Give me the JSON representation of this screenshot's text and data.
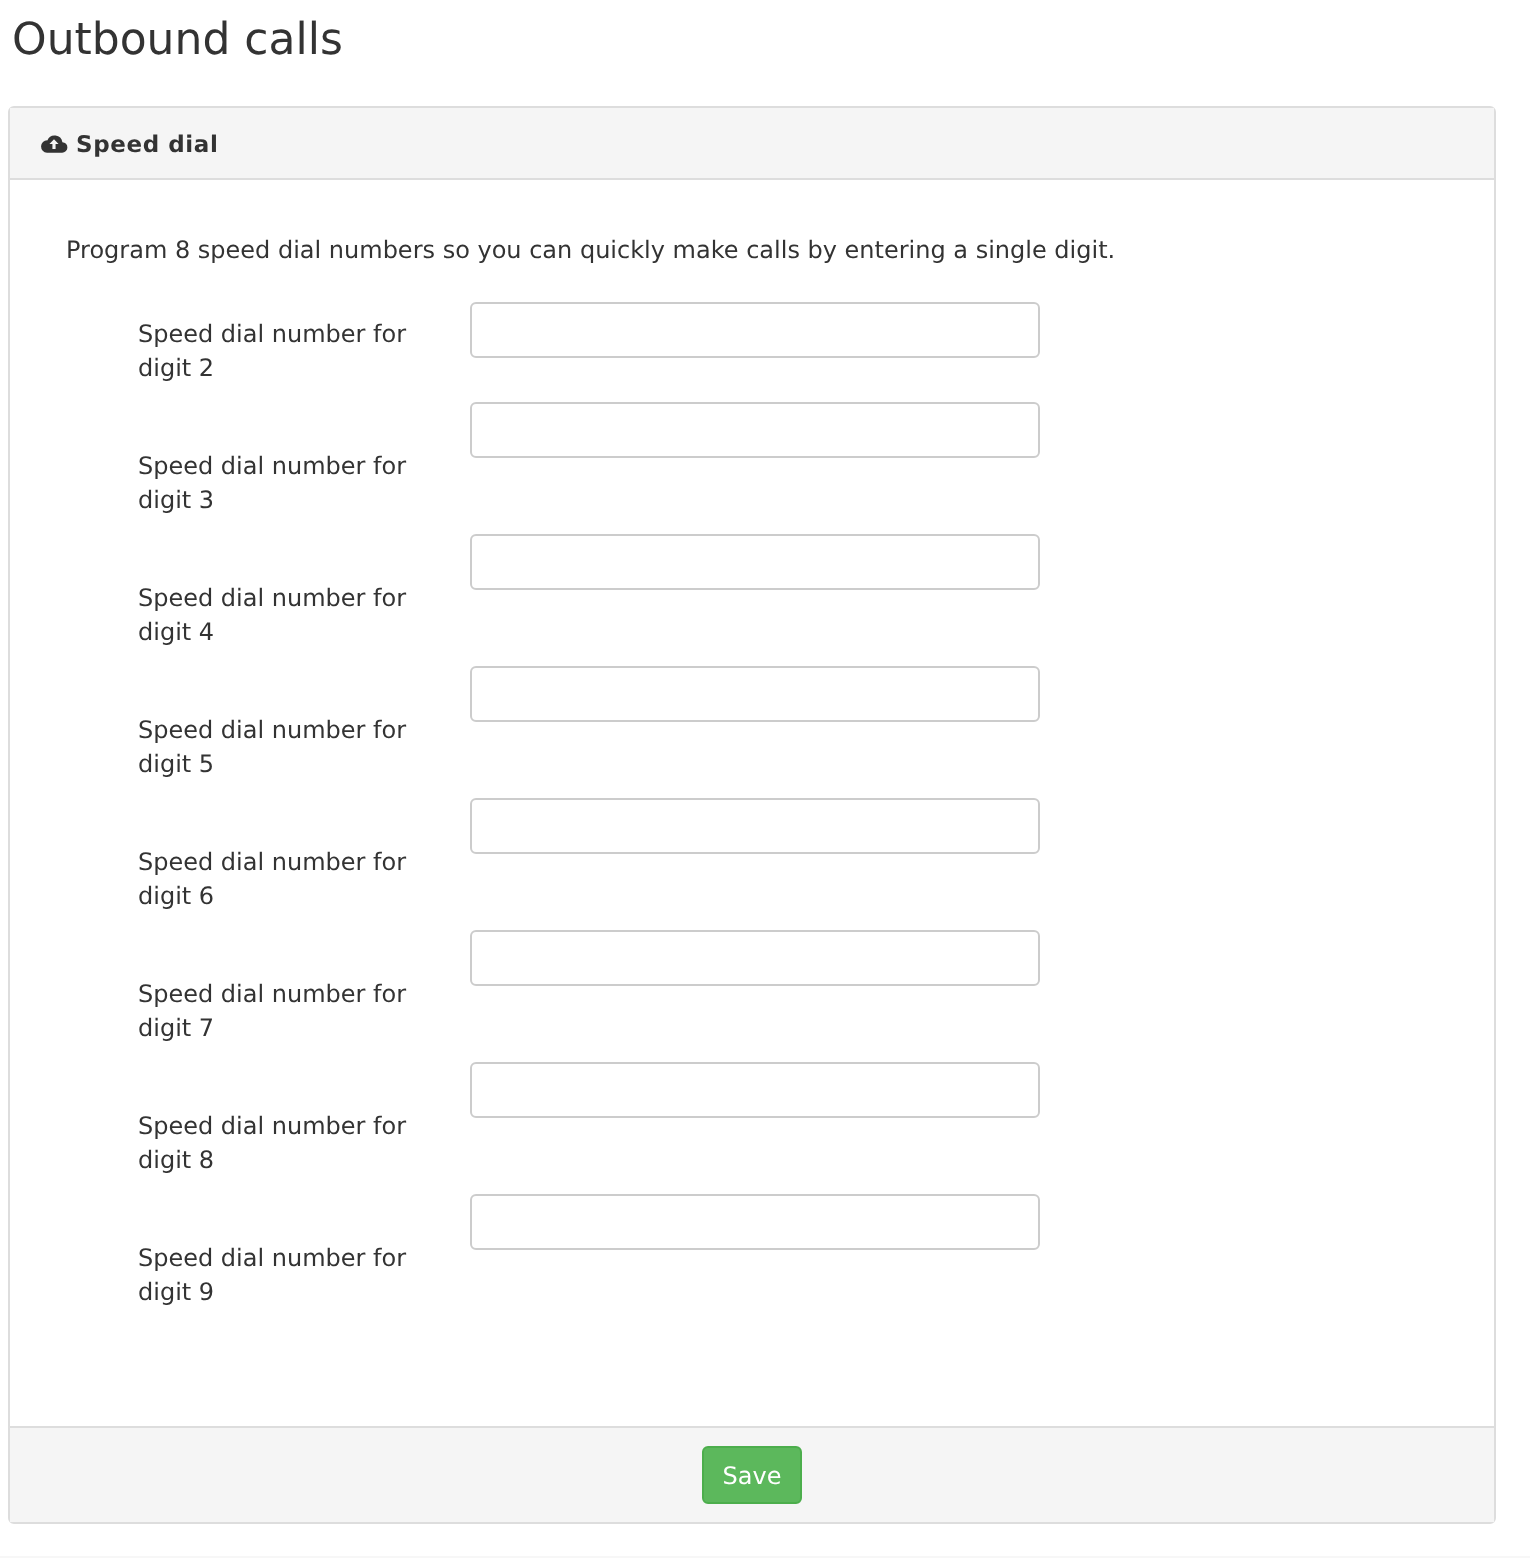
{
  "page_title": "Outbound calls",
  "panel": {
    "heading": "Speed dial",
    "intro": "Program 8 speed dial numbers so you can quickly make calls by entering a single digit.",
    "fields": [
      {
        "label": "Speed dial number for digit 2"
      },
      {
        "label": "Speed dial number for digit 3"
      },
      {
        "label": "Speed dial number for digit 4"
      },
      {
        "label": "Speed dial number for digit 5"
      },
      {
        "label": "Speed dial number for digit 6"
      },
      {
        "label": "Speed dial number for digit 7"
      },
      {
        "label": "Speed dial number for digit 8"
      },
      {
        "label": "Speed dial number for digit 9"
      }
    ],
    "buttons": [
      "Save"
    ]
  }
}
